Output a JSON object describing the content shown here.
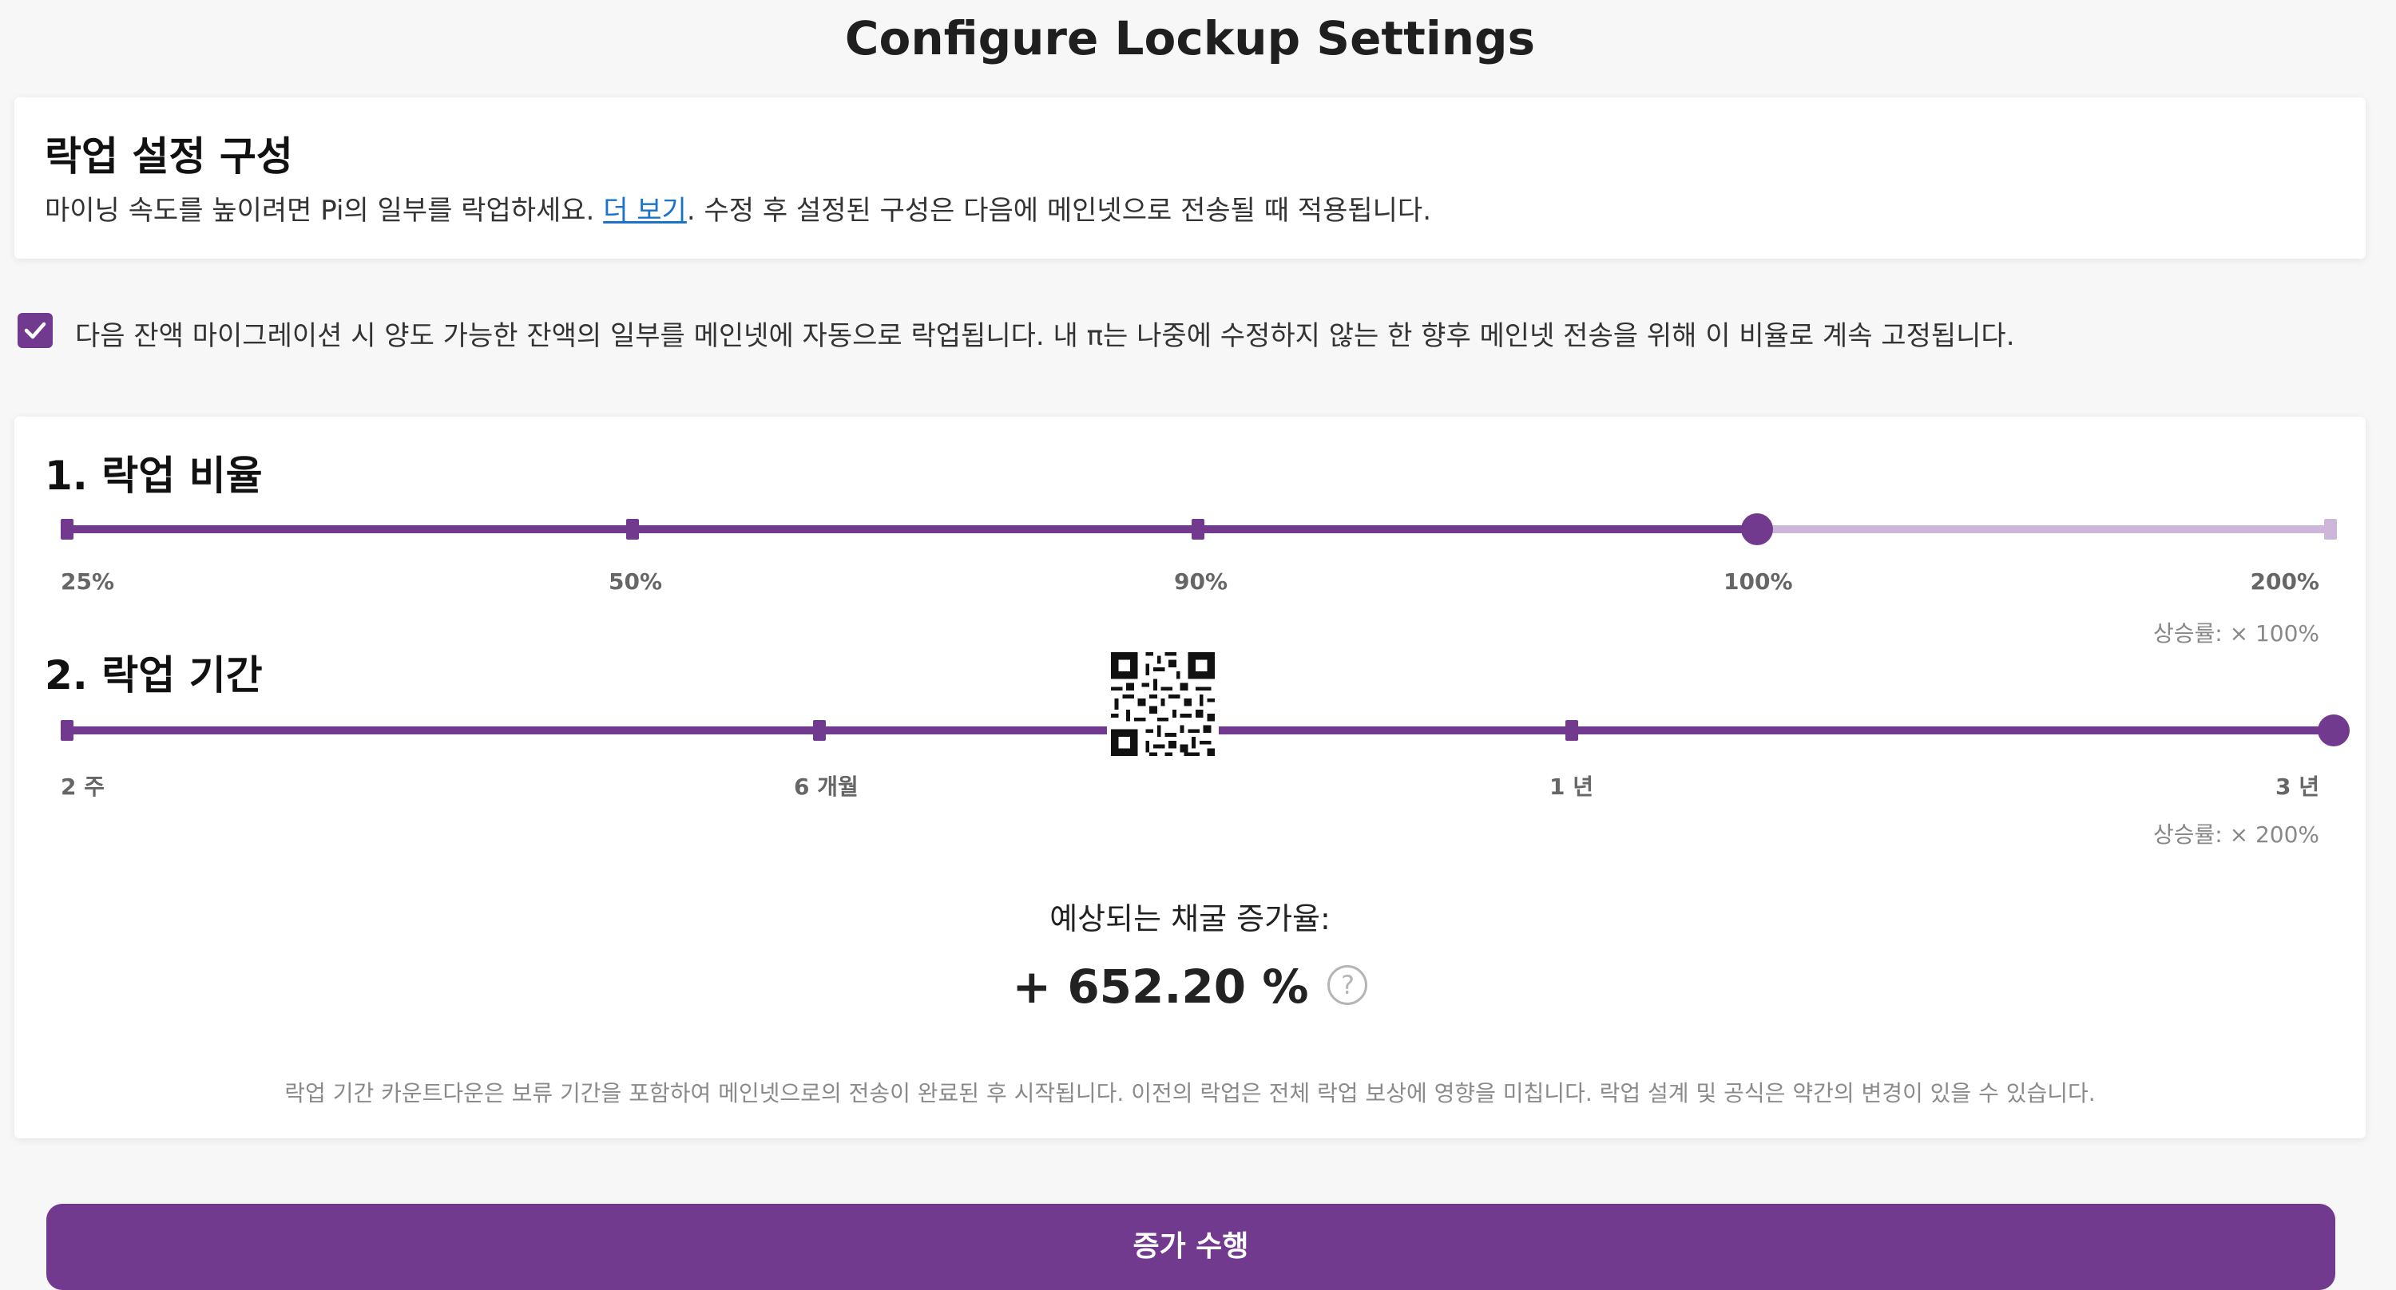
{
  "header": {
    "title": "Configure Lockup Settings"
  },
  "intro": {
    "heading": "락업 설정 구성",
    "text_before": "마이닝 속도를 높이려면 Pi의 일부를 락업하세요. ",
    "link": "더 보기",
    "text_after": ". 수정 후 설정된 구성은 다음에 메인넷으로 전송될 때 적용됩니다."
  },
  "auto_lockup": {
    "checked": true,
    "text": "다음 잔액 마이그레이션 시 양도 가능한 잔액의 일부를 메인넷에 자동으로 락업됩니다. 내 π는 나중에 수정하지 않는 한 향후 메인넷 전송을 위해 이 비율로 계속 고정됩니다."
  },
  "ratio": {
    "title": "1. 락업 비율",
    "labels": [
      "25%",
      "50%",
      "90%",
      "100%",
      "200%"
    ],
    "selected_index": 3,
    "multiplier": "상승률: × 100%"
  },
  "duration": {
    "title": "2. 락업 기간",
    "labels": [
      "2 주",
      "6 개월",
      "1 년",
      "3 년"
    ],
    "selected_index": 3,
    "multiplier": "상승률: × 200%"
  },
  "result": {
    "label": "예상되는 채굴 증가율:",
    "value": "+ 652.20 %",
    "help_glyph": "?"
  },
  "footnote": "락업 기간 카운트다운은 보류 기간을 포함하여 메인넷으로의 전송이 완료된 후 시작됩니다. 이전의 락업은 전체 락업 보상에 영향을 미칩니다. 락업 설계 및 공식은 약간의 변경이 있을 수 있습니다.",
  "cta": {
    "label": "증가 수행"
  },
  "colors": {
    "accent": "#723a8f",
    "accent_light": "#cdb6da",
    "link": "#1a73c9"
  }
}
